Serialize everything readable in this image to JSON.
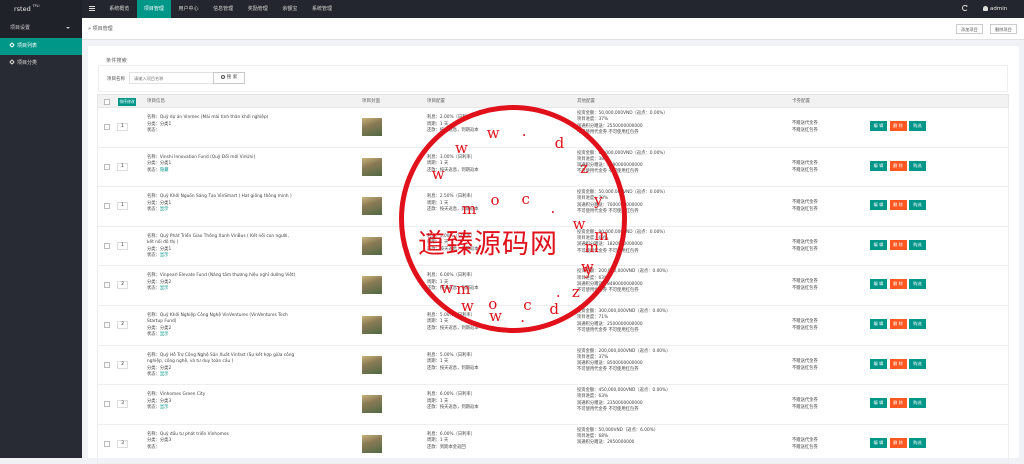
{
  "app": {
    "logo": "rsted",
    "logo_sup": "TPL!",
    "user": "admin"
  },
  "topnav": [
    "系统概览",
    "项目管理",
    "用户中心",
    "信息管理",
    "奖励管理",
    "余额宝",
    "系统管理"
  ],
  "topnav_active": 1,
  "sidebar": {
    "section": "项目设置",
    "items": [
      "项目列表",
      "项目分类"
    ],
    "active": 0
  },
  "tabs": {
    "crumb": "项目管理",
    "add_button": "添加项目",
    "delete_button": "删除项目"
  },
  "filter": {
    "title": "条件搜索",
    "label": "项目名称",
    "placeholder": "请输入项目名称",
    "search_button": "搜 索"
  },
  "table": {
    "headers": {
      "sort_button": "排序修改",
      "name": "项目信息",
      "image": "项目封面",
      "config": "项目配置",
      "info": "其他配置",
      "card": "卡券配置"
    },
    "actions": {
      "edit": "编 辑",
      "delete": "删 除",
      "buy": "购选"
    },
    "rows": [
      {
        "sort": "1",
        "name": "名称：Quỹ dự án Vinmec (Mái mái tình thân khởi nghiệp)",
        "cat": "分类：分类1",
        "status_label": "状态：",
        "status": "",
        "cfg": [
          "利息：2.00%（日利率）",
          "周期：1 天",
          "还款：按天返息，到期返本"
        ],
        "info": [
          "投资金额：50,000,000VND（返点：0.00%）",
          "项目进度：37%",
          "润通积分赠送：2550000000000",
          "不可使用代金券   不可使用红包券"
        ],
        "card": [
          "不赠送代金券",
          "不赠送红包券"
        ]
      },
      {
        "sort": "1",
        "name": "名称：Vinshi Innovation Fund (Quỹ Đổi mới VinUni)",
        "cat": "分类：分类1",
        "status_label": "状态：",
        "status": "隐藏",
        "cfg": [
          "利息：3.00%（日利率）",
          "周期：1 天",
          "还款：按天返息，到期返本"
        ],
        "info": [
          "投资金额：80,000,000VND（返点：0.00%）",
          "项目进度：38%",
          "润通积分赠送：4080000000000",
          "不可使用代金券   不可使用红包券"
        ],
        "card": [
          "不赠送代金券",
          "不赠送红包券"
        ]
      },
      {
        "sort": "1",
        "name": "名称：Quỹ Khởi Nguồn Sáng Tạo VinSmart ( Hạt giống thông minh )",
        "cat": "分类：分类1",
        "status_label": "状态：",
        "status": "显示",
        "cfg": [
          "利息：2.50%（日利率）",
          "周期：1 天",
          "还款：按天返息，到期返本"
        ],
        "info": [
          "投资金额：50,000,000VND（返点：0.00%）",
          "项目进度：70%",
          "润通积分赠送：7000000000000",
          "不可使用代金券   不可使用红包券"
        ],
        "card": [
          "不赠送代金券",
          "不赠送红包券"
        ]
      },
      {
        "sort": "1",
        "name": "名称：Quỹ Phát Triển Giao Thông Xanh VinBus ( Kết nối con người, kết nối đô thị )",
        "cat": "分类：分类1",
        "status_label": "状态：",
        "status": "显示",
        "cfg": [
          "利息：5.00%（日利率）",
          "周期：1 天",
          "还款：按天返息，到期返本"
        ],
        "info": [
          "投资金额：90,000,000VND（返点：0.00%）",
          "项目进度：69%",
          "润通积分赠送：1820000000000",
          "不可使用代金券   不可使用红包券"
        ],
        "card": [
          "不赠送代金券",
          "不赠送红包券"
        ]
      },
      {
        "sort": "2",
        "name": "名称：Vinpearl Elevate Fund (Nâng tầm thương hiệu nghỉ dưỡng Việt)",
        "cat": "分类：分类2",
        "status_label": "状态：",
        "status": "显示",
        "cfg": [
          "利息：6.00%（日利率）",
          "周期：1 天",
          "还款：按天返息，到期返本"
        ],
        "info": [
          "投资金额：200,000,000VND（返点：0.00%）",
          "项目进度：63%",
          "润通积分赠送：8480000000000",
          "不可使用代金券   不可使用红包券"
        ],
        "card": [
          "不赠送代金券",
          "不赠送红包券"
        ]
      },
      {
        "sort": "2",
        "name": "名称：Quỹ Khởi Nghiệp Công Nghệ VinVentures (VinVentures Tech Startup Fund)",
        "cat": "分类：分类2",
        "status_label": "状态：",
        "status": "显示",
        "cfg": [
          "利息：5.00%（日利率）",
          "周期：1 天",
          "还款：按天返息，到期返本"
        ],
        "info": [
          "投资金额：300,000,000VND（返点：0.00%）",
          "项目进度：71%",
          "润通积分赠送：2500000000000",
          "不可使用代金券   不可使用红包券"
        ],
        "card": [
          "不赠送代金券",
          "不赠送红包券"
        ]
      },
      {
        "sort": "2",
        "name": "名称：Quỹ Hỗ Trợ Công Nghệ Sản Xuất Vinfast (Sự kết hợp giữa công nghiệp, công nghệ, và tư duy toàn cầu )",
        "cat": "分类：分类2",
        "status_label": "状态：",
        "status": "显示",
        "cfg": [
          "利息：5.00%（日利率）",
          "周期：1 天",
          "还款：按天返息，到期返本"
        ],
        "info": [
          "投资金额：200,000,000VND（返点：0.00%）",
          "项目进度：37%",
          "润通积分赠送：8500000000000",
          "不可使用代金券   不可使用红包券"
        ],
        "card": [
          "不赠送代金券",
          "不赠送红包券"
        ]
      },
      {
        "sort": "3",
        "name": "名称：Vinhomes Green City",
        "cat": "分类：分类3",
        "status_label": "状态：",
        "status": "显示",
        "cfg": [
          "利息：6.00%（日利率）",
          "周期：1 天",
          "还款：按天返息，到期返本"
        ],
        "info": [
          "投资金额：450,000,000VND（返点：0.00%）",
          "项目进度：63%",
          "润通积分赠送：2350000000000",
          "不可使用代金券   不可使用红包券"
        ],
        "card": [
          "不赠送代金券",
          "不赠送红包券"
        ]
      },
      {
        "sort": "3",
        "name": "名称：Quỹ đầu tư phát triển Vinhomes",
        "cat": "分类：分类3",
        "status_label": "状态：",
        "status": "",
        "cfg": [
          "利息：6.00%（日利率）",
          "周期：1 天",
          "还款：到期本金返回"
        ],
        "info": [
          "投资金额：50,000VND（返点：6.00%）",
          "项目进度：68%",
          "润通积分赠送：2950000000",
          ""
        ],
        "card": [
          "不赠送代金券",
          "不赠送红包券"
        ]
      }
    ]
  },
  "watermark": {
    "title": "道臻源码网",
    "url_chars": [
      "w",
      "w",
      "w",
      ".",
      "d",
      "z",
      "y",
      "m",
      "w",
      ".",
      "c",
      "o",
      "m"
    ],
    "color": "#e0111a"
  }
}
